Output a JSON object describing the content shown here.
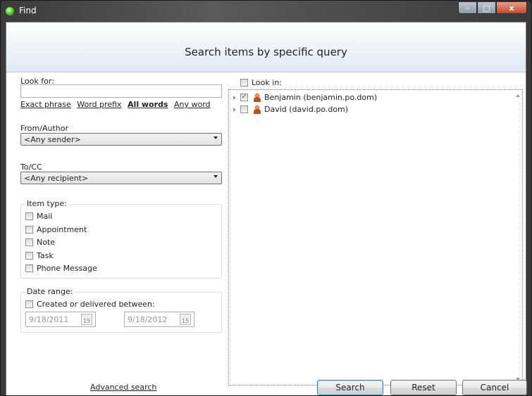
{
  "window": {
    "title": "Find",
    "minimize": "–",
    "maximize": "□",
    "close": "x"
  },
  "header": {
    "title": "Search items by specific query"
  },
  "look_for": {
    "label": "Look for:",
    "value": "",
    "modes": [
      "Exact phrase",
      "Word prefix",
      "All words",
      "Any word"
    ],
    "selected_mode": "All words"
  },
  "from": {
    "label": "From/Author",
    "value": "<Any sender>"
  },
  "to": {
    "label": "To/CC",
    "value": "<Any recipient>"
  },
  "item_type": {
    "title": "Item type:",
    "items": [
      {
        "label": "Mail",
        "checked": false
      },
      {
        "label": "Appointment",
        "checked": false
      },
      {
        "label": "Note",
        "checked": false
      },
      {
        "label": "Task",
        "checked": false
      },
      {
        "label": "Phone Message",
        "checked": false
      }
    ]
  },
  "date_range": {
    "title": "Date range:",
    "checkbox_label": "Created or delivered between:",
    "from": "9/18/2011",
    "to": "9/18/2012",
    "cal_icon": "15"
  },
  "look_in": {
    "label": "Look in:",
    "tree": [
      {
        "label": "Benjamin (benjamin.po.dom)",
        "checked": true
      },
      {
        "label": "David (david.po.dom)",
        "checked": false
      }
    ]
  },
  "footer": {
    "advanced": "Advanced search",
    "search": "Search",
    "reset": "Reset",
    "cancel": "Cancel"
  },
  "icons": [
    "app-icon",
    "user-icon",
    "calendar-icon",
    "expander-icon"
  ]
}
